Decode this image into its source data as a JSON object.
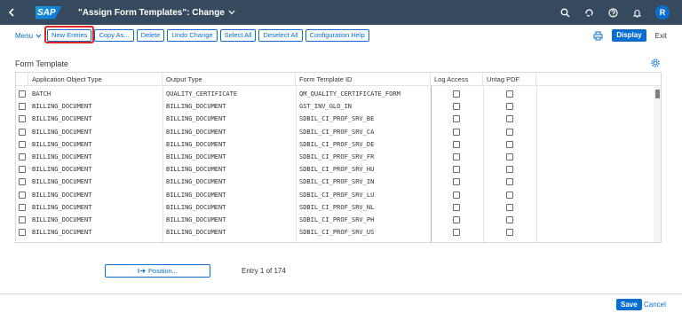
{
  "shell": {
    "logo": "SAP",
    "title": "\"Assign Form Templates\": Change",
    "avatar": "R"
  },
  "toolbar": {
    "menu": "Menu",
    "buttons": [
      "New Entries",
      "Copy As...",
      "Delete",
      "Undo Change",
      "Select All",
      "Deselect All",
      "Configuration Help"
    ],
    "display": "Display",
    "exit": "Exit"
  },
  "section": {
    "title": "Form Template"
  },
  "table": {
    "columns": [
      "Application Object Type",
      "Output Type",
      "Form Template ID",
      "Log Access",
      "Untag PDF"
    ],
    "rows": [
      [
        "BATCH",
        "QUALITY_CERTIFICATE",
        "QM_QUALITY_CERTIFICATE_FORM"
      ],
      [
        "BILLING_DOCUMENT",
        "BILLING_DOCUMENT",
        "GST_INV_GLO_IN"
      ],
      [
        "BILLING_DOCUMENT",
        "BILLING_DOCUMENT",
        "SDBIL_CI_PROF_SRV_BE"
      ],
      [
        "BILLING_DOCUMENT",
        "BILLING_DOCUMENT",
        "SDBIL_CI_PROF_SRV_CA"
      ],
      [
        "BILLING_DOCUMENT",
        "BILLING_DOCUMENT",
        "SDBIL_CI_PROF_SRV_DE"
      ],
      [
        "BILLING_DOCUMENT",
        "BILLING_DOCUMENT",
        "SDBIL_CI_PROF_SRV_FR"
      ],
      [
        "BILLING_DOCUMENT",
        "BILLING_DOCUMENT",
        "SDBIL_CI_PROF_SRV_HU"
      ],
      [
        "BILLING_DOCUMENT",
        "BILLING_DOCUMENT",
        "SDBIL_CI_PROF_SRV_IN"
      ],
      [
        "BILLING_DOCUMENT",
        "BILLING_DOCUMENT",
        "SDBIL_CI_PROF_SRV_LU"
      ],
      [
        "BILLING_DOCUMENT",
        "BILLING_DOCUMENT",
        "SDBIL_CI_PROF_SRV_NL"
      ],
      [
        "BILLING_DOCUMENT",
        "BILLING_DOCUMENT",
        "SDBIL_CI_PROF_SRV_PH"
      ],
      [
        "BILLING_DOCUMENT",
        "BILLING_DOCUMENT",
        "SDBIL_CI_PROF_SRV_US"
      ]
    ]
  },
  "footer": {
    "position": "Position...",
    "entry": "Entry 1 of 174",
    "save": "Save",
    "cancel": "Cancel"
  },
  "colors": {
    "shell": "#354a5f",
    "accent": "#0a6ed1",
    "highlight": "#e2231a"
  },
  "icons": [
    "back-icon",
    "chevron-down-icon",
    "search-icon",
    "notifications-sync-icon",
    "help-icon",
    "bell-icon",
    "print-icon",
    "settings-icon",
    "position-icon"
  ]
}
